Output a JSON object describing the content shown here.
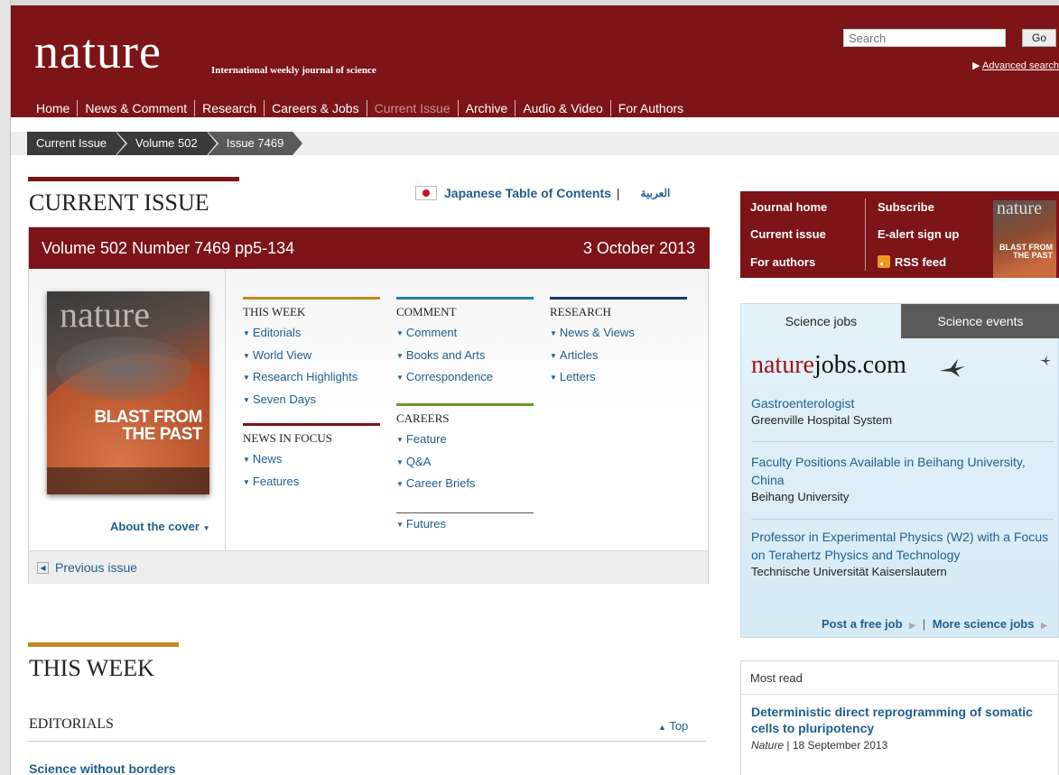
{
  "header": {
    "logo": "nature",
    "tagline": "International weekly journal of science",
    "search": {
      "placeholder": "Search",
      "button": "Go"
    },
    "advanced_search": "Advanced search",
    "nav": [
      "Home",
      "News & Comment",
      "Research",
      "Careers & Jobs",
      "Current Issue",
      "Archive",
      "Audio & Video",
      "For Authors"
    ],
    "nav_current": "Current Issue"
  },
  "breadcrumb": [
    "Current Issue",
    "Volume 502",
    "Issue 7469"
  ],
  "current_issue": {
    "title": "CURRENT ISSUE",
    "japanese_toc": "Japanese Table of Contents",
    "arabic": "العربية",
    "volume": "Volume 502 Number 7469 pp5-134",
    "date": "3 October 2013",
    "cover": {
      "logo": "nature",
      "title_line1": "BLAST FROM",
      "title_line2": "THE PAST"
    },
    "about_cover": "About the cover",
    "columns": {
      "this_week": {
        "heading": "THIS WEEK",
        "items": [
          "Editorials",
          "World View",
          "Research Highlights",
          "Seven Days"
        ]
      },
      "news_in_focus": {
        "heading": "NEWS IN FOCUS",
        "items": [
          "News",
          "Features"
        ]
      },
      "comment": {
        "heading": "COMMENT",
        "items": [
          "Comment",
          "Books and Arts",
          "Correspondence"
        ]
      },
      "careers": {
        "heading": "CAREERS",
        "items": [
          "Feature",
          "Q&A",
          "Career Briefs"
        ]
      },
      "futures": {
        "items": [
          "Futures"
        ]
      },
      "research": {
        "heading": "RESEARCH",
        "items": [
          "News & Views",
          "Articles",
          "Letters"
        ]
      }
    },
    "previous_issue": "Previous issue"
  },
  "this_week_section": {
    "title": "THIS WEEK",
    "subsection": "EDITORIALS",
    "top_link": "Top",
    "first_article": "Science without borders"
  },
  "sidebar": {
    "journal_links": [
      "Journal home",
      "Current issue",
      "For authors"
    ],
    "subscribe_links": [
      "Subscribe",
      "E-alert sign up",
      "RSS feed"
    ],
    "mini_cover": {
      "logo": "nature",
      "title_line1": "BLAST FROM",
      "title_line2": "THE PAST"
    },
    "jobs": {
      "tab_jobs": "Science jobs",
      "tab_events": "Science events",
      "logo_red": "nature",
      "logo_black": "jobs.com",
      "listings": [
        {
          "title": "Gastroenterologist",
          "org": "Greenville Hospital System"
        },
        {
          "title": "Faculty Positions Available in Beihang University, China",
          "org": "Beihang University"
        },
        {
          "title": "Professor in Experimental Physics (W2) with a Focus on Terahertz Physics and Technology",
          "org": "Technische Universität Kaiserslautern"
        }
      ],
      "post_job": "Post a free job",
      "more_jobs": "More science jobs"
    },
    "most_read": {
      "heading": "Most read",
      "items": [
        {
          "title": "Deterministic direct reprogramming of somatic cells to pluripotency",
          "journal": "Nature",
          "date": "18 September 2013"
        }
      ]
    }
  },
  "colors": {
    "brand_red": "#7c1418",
    "link_blue": "#1f5f8e",
    "this_week_gold": "#c08a1e",
    "comment_teal": "#2a7fa8",
    "careers_green": "#6a9a2a",
    "research_navy": "#1e3a66",
    "news_red": "#7c1418"
  }
}
